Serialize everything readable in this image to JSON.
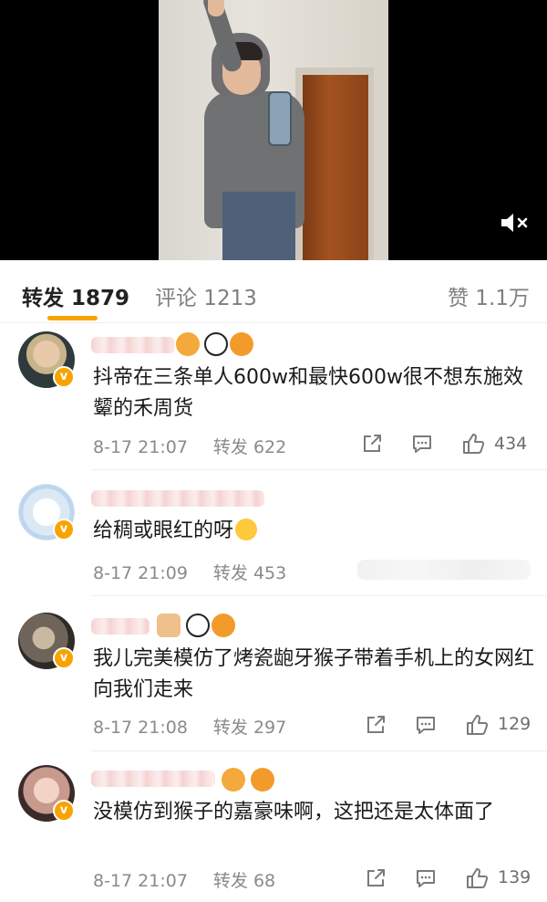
{
  "tabs": {
    "repost": "转发 1879",
    "comment": "评论 1213",
    "like": "赞 1.1万"
  },
  "comments": [
    {
      "text": "抖帝在三条单人600w和最快600w很不想东施效颦的禾周货",
      "date": "8-17 21:07",
      "repost": "转发 622",
      "likes": "434"
    },
    {
      "text": "给稠或眼红的呀",
      "date": "8-17 21:09",
      "repost": "转发 453",
      "likes": ""
    },
    {
      "text": "我儿完美模仿了烤瓷龅牙猴子带着手机上的女网红向我们走来",
      "date": "8-17 21:08",
      "repost": "转发 297",
      "likes": "129"
    },
    {
      "text": "没模仿到猴子的嘉豪味啊，这把还是太体面了",
      "date": "8-17 21:07",
      "repost": "转发 68",
      "likes": "139"
    }
  ],
  "avatars": [
    "avatar-1",
    "avatar-2",
    "avatar-3",
    "avatar-4"
  ],
  "icons": {
    "mute": "mute-icon",
    "share": "share-icon",
    "reply": "comment-icon",
    "like": "thumbs-up-icon",
    "verified": "verified-badge-icon"
  },
  "colors": {
    "accent": "#f7a300",
    "meta_text": "#8a8a8a",
    "divider": "#eeeeee"
  }
}
